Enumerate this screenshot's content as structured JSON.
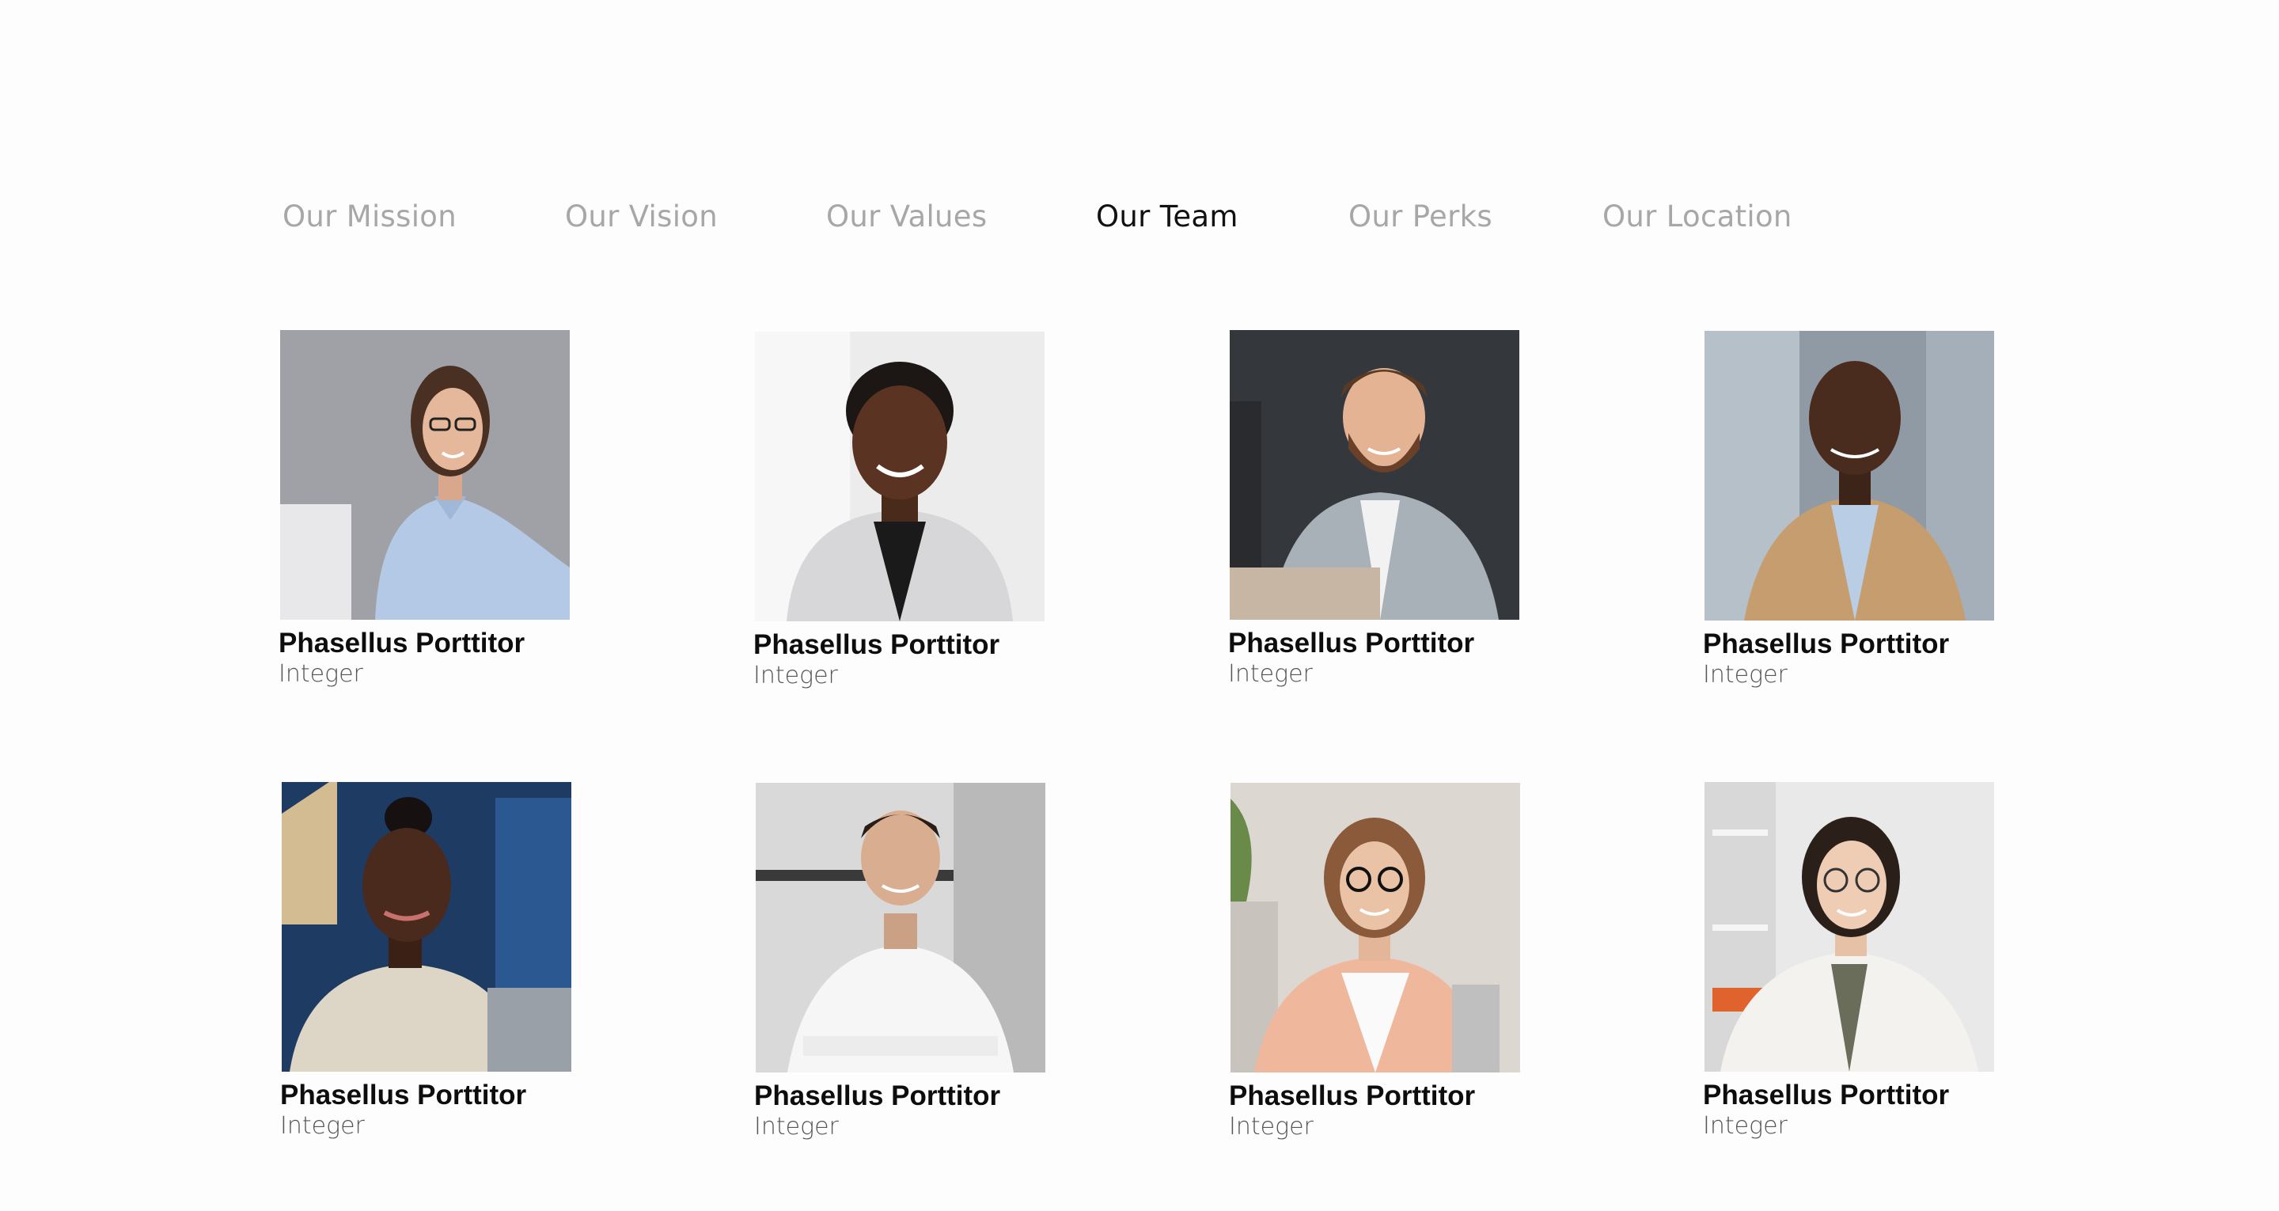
{
  "tabs": [
    {
      "label": "Our Mission",
      "active": false
    },
    {
      "label": "Our Vision",
      "active": false
    },
    {
      "label": "Our Values",
      "active": false
    },
    {
      "label": "Our Team",
      "active": true
    },
    {
      "label": "Our Perks",
      "active": false
    },
    {
      "label": "Our Location",
      "active": false
    }
  ],
  "team": [
    {
      "name": "Phasellus Porttitor",
      "role": "Integer",
      "photo": "woman-glasses-blue-shirt-photo"
    },
    {
      "name": "Phasellus Porttitor",
      "role": "Integer",
      "photo": "woman-short-hair-blazer-photo"
    },
    {
      "name": "Phasellus Porttitor",
      "role": "Integer",
      "photo": "bearded-man-grey-blazer-photo"
    },
    {
      "name": "Phasellus Porttitor",
      "role": "Integer",
      "photo": "older-man-tan-blazer-photo"
    },
    {
      "name": "Phasellus Porttitor",
      "role": "Integer",
      "photo": "woman-laptop-blue-room-photo"
    },
    {
      "name": "Phasellus Porttitor",
      "role": "Integer",
      "photo": "man-white-shirt-arms-crossed-photo"
    },
    {
      "name": "Phasellus Porttitor",
      "role": "Integer",
      "photo": "woman-glasses-peach-blazer-photo"
    },
    {
      "name": "Phasellus Porttitor",
      "role": "Integer",
      "photo": "woman-glasses-white-jacket-photo"
    }
  ],
  "colors": {
    "tab_inactive": "#a7a7a7",
    "tab_active": "#111111",
    "background": "#fdfdfd"
  }
}
